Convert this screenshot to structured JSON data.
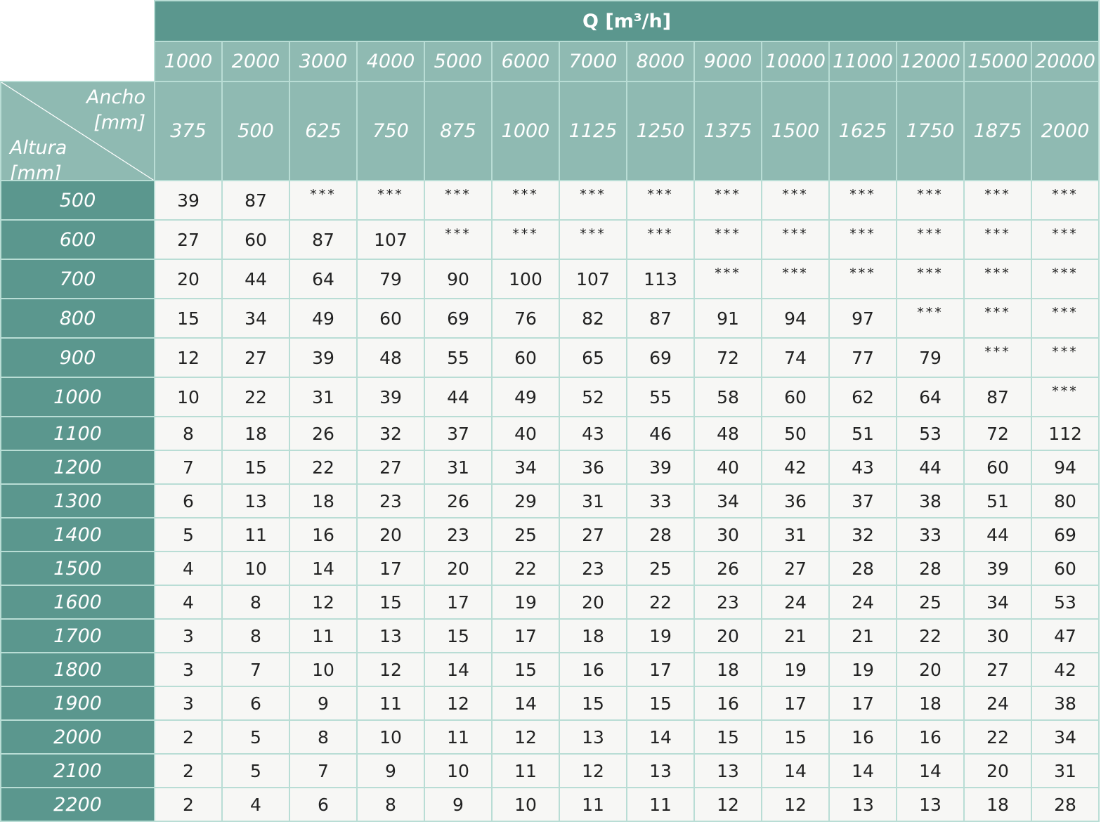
{
  "table": {
    "q_label": "Q [m³/h]",
    "corner": {
      "ancho_line1": "Ancho",
      "ancho_line2": "[mm]",
      "altura_line1": "Altura",
      "altura_line2": "[mm]"
    },
    "q_values": [
      "1000",
      "2000",
      "3000",
      "4000",
      "5000",
      "6000",
      "7000",
      "8000",
      "9000",
      "10000",
      "11000",
      "12000",
      "15000",
      "20000"
    ],
    "ancho_values": [
      "375",
      "500",
      "625",
      "750",
      "875",
      "1000",
      "1125",
      "1250",
      "1375",
      "1500",
      "1625",
      "1750",
      "1875",
      "2000"
    ],
    "rows": [
      {
        "altura": "500",
        "cells": [
          "39",
          "87",
          "***",
          "***",
          "***",
          "***",
          "***",
          "***",
          "***",
          "***",
          "***",
          "***",
          "***",
          "***"
        ]
      },
      {
        "altura": "600",
        "cells": [
          "27",
          "60",
          "87",
          "107",
          "***",
          "***",
          "***",
          "***",
          "***",
          "***",
          "***",
          "***",
          "***",
          "***"
        ]
      },
      {
        "altura": "700",
        "cells": [
          "20",
          "44",
          "64",
          "79",
          "90",
          "100",
          "107",
          "113",
          "***",
          "***",
          "***",
          "***",
          "***",
          "***"
        ]
      },
      {
        "altura": "800",
        "cells": [
          "15",
          "34",
          "49",
          "60",
          "69",
          "76",
          "82",
          "87",
          "91",
          "94",
          "97",
          "***",
          "***",
          "***"
        ]
      },
      {
        "altura": "900",
        "cells": [
          "12",
          "27",
          "39",
          "48",
          "55",
          "60",
          "65",
          "69",
          "72",
          "74",
          "77",
          "79",
          "***",
          "***"
        ]
      },
      {
        "altura": "1000",
        "cells": [
          "10",
          "22",
          "31",
          "39",
          "44",
          "49",
          "52",
          "55",
          "58",
          "60",
          "62",
          "64",
          "87",
          "***"
        ]
      },
      {
        "altura": "1100",
        "cells": [
          "8",
          "18",
          "26",
          "32",
          "37",
          "40",
          "43",
          "46",
          "48",
          "50",
          "51",
          "53",
          "72",
          "112"
        ]
      },
      {
        "altura": "1200",
        "cells": [
          "7",
          "15",
          "22",
          "27",
          "31",
          "34",
          "36",
          "39",
          "40",
          "42",
          "43",
          "44",
          "60",
          "94"
        ]
      },
      {
        "altura": "1300",
        "cells": [
          "6",
          "13",
          "18",
          "23",
          "26",
          "29",
          "31",
          "33",
          "34",
          "36",
          "37",
          "38",
          "51",
          "80"
        ]
      },
      {
        "altura": "1400",
        "cells": [
          "5",
          "11",
          "16",
          "20",
          "23",
          "25",
          "27",
          "28",
          "30",
          "31",
          "32",
          "33",
          "44",
          "69"
        ]
      },
      {
        "altura": "1500",
        "cells": [
          "4",
          "10",
          "14",
          "17",
          "20",
          "22",
          "23",
          "25",
          "26",
          "27",
          "28",
          "28",
          "39",
          "60"
        ]
      },
      {
        "altura": "1600",
        "cells": [
          "4",
          "8",
          "12",
          "15",
          "17",
          "19",
          "20",
          "22",
          "23",
          "24",
          "24",
          "25",
          "34",
          "53"
        ]
      },
      {
        "altura": "1700",
        "cells": [
          "3",
          "8",
          "11",
          "13",
          "15",
          "17",
          "18",
          "19",
          "20",
          "21",
          "21",
          "22",
          "30",
          "47"
        ]
      },
      {
        "altura": "1800",
        "cells": [
          "3",
          "7",
          "10",
          "12",
          "14",
          "15",
          "16",
          "17",
          "18",
          "19",
          "19",
          "20",
          "27",
          "42"
        ]
      },
      {
        "altura": "1900",
        "cells": [
          "3",
          "6",
          "9",
          "11",
          "12",
          "14",
          "15",
          "15",
          "16",
          "17",
          "17",
          "18",
          "24",
          "38"
        ]
      },
      {
        "altura": "2000",
        "cells": [
          "2",
          "5",
          "8",
          "10",
          "11",
          "12",
          "13",
          "14",
          "15",
          "15",
          "16",
          "16",
          "22",
          "34"
        ]
      },
      {
        "altura": "2100",
        "cells": [
          "2",
          "5",
          "7",
          "9",
          "10",
          "11",
          "12",
          "13",
          "13",
          "14",
          "14",
          "14",
          "20",
          "31"
        ]
      },
      {
        "altura": "2200",
        "cells": [
          "2",
          "4",
          "6",
          "8",
          "9",
          "10",
          "11",
          "11",
          "12",
          "12",
          "13",
          "13",
          "18",
          "28"
        ]
      }
    ]
  },
  "colors": {
    "header_dark": "#5b978e",
    "header_light": "#8fbab2",
    "cell_bg": "#f7f7f5",
    "grid_line": "#b9ddd5"
  }
}
